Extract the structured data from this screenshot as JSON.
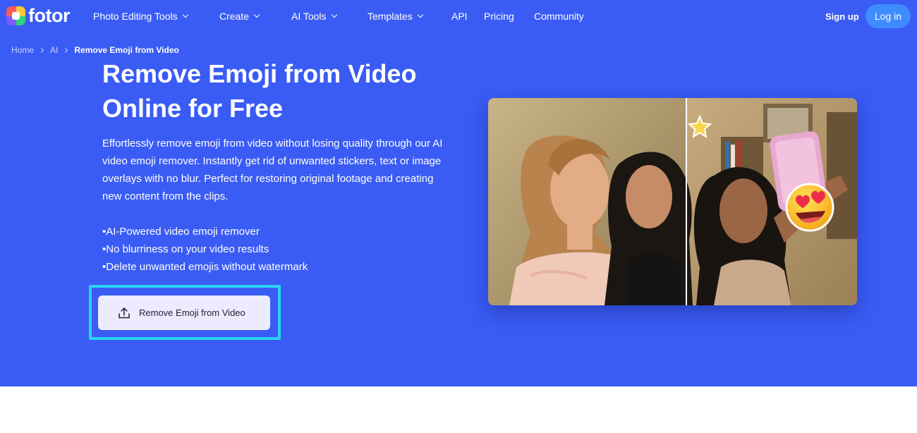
{
  "brand": {
    "logo_text": "fotor"
  },
  "nav": {
    "items": [
      {
        "label": "Photo Editing Tools",
        "dropdown": true
      },
      {
        "label": "Create",
        "dropdown": true
      },
      {
        "label": "AI Tools",
        "dropdown": true
      },
      {
        "label": "Templates",
        "dropdown": true
      },
      {
        "label": "API",
        "dropdown": false
      },
      {
        "label": "Pricing",
        "dropdown": false
      },
      {
        "label": "Community",
        "dropdown": false
      }
    ],
    "sign_up": "Sign up",
    "log_in": "Log in"
  },
  "breadcrumb": [
    "Home",
    "AI",
    "Remove Emoji from Video"
  ],
  "hero": {
    "title_line1": "Remove Emoji from Video",
    "title_line2": "Online for Free",
    "description": "Effortlessly remove emoji from video without losing quality through our AI video emoji remover. Instantly get rid of unwanted stickers, text or image overlays with no blur. Perfect for restoring original footage and creating new content from the clips.",
    "bullets": [
      "•AI-Powered video emoji remover",
      "•No blurriness on your video results",
      "•Delete unwanted emojis without watermark"
    ],
    "cta_label": "Remove Emoji from Video"
  },
  "colors": {
    "hero_bg": "#3a5cf5",
    "login_bg": "#3f8cff",
    "cta_bg": "#ecebff",
    "highlight": "#29d3f2"
  },
  "icons": {
    "upload": "upload-icon",
    "chevron": "chevron-down-icon",
    "separator": "chevron-right-icon"
  }
}
